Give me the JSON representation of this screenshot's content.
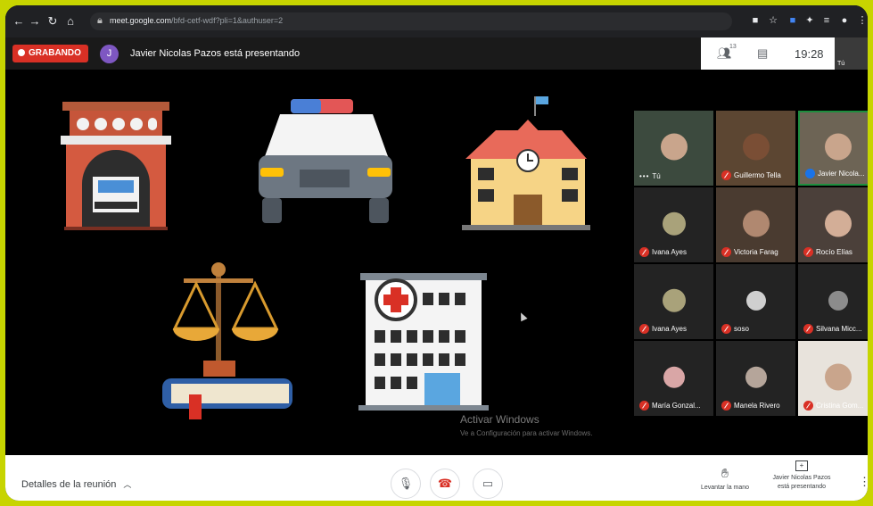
{
  "browser": {
    "url_host": "meet.google.com",
    "url_path": "/bfd-cetf-wdf?pli=1&authuser=2"
  },
  "meet": {
    "recording_label": "GRABANDO",
    "presenter_initial": "J",
    "presenting_text": "Javier Nicolas Pazos está presentando",
    "participant_count": "13",
    "time": "19:28",
    "self_label": "Tú"
  },
  "watermark": {
    "line1": "Activar Windows",
    "line2": "Ve a Configuración para activar Windows."
  },
  "participants": [
    {
      "name": "Tú",
      "muted": false,
      "self": true
    },
    {
      "name": "Guillermo Tella",
      "muted": true
    },
    {
      "name": "Javier Nicola...",
      "muted": false,
      "speaking": true
    },
    {
      "name": "Ivana Ayes",
      "muted": true
    },
    {
      "name": "Victoria Farag",
      "muted": true
    },
    {
      "name": "Rocío Elías",
      "muted": true
    },
    {
      "name": "Ivana Ayes",
      "muted": true
    },
    {
      "name": "soso",
      "muted": true
    },
    {
      "name": "Silvana Micc...",
      "muted": true
    },
    {
      "name": "María Gonzal...",
      "muted": true
    },
    {
      "name": "Manela Rivero",
      "muted": true
    },
    {
      "name": "Cristina Gom...",
      "muted": true
    }
  ],
  "bottom": {
    "details_label": "Detalles de la reunión",
    "raise_hand_label": "Levantar la mano",
    "presenting_line1": "Javier Nicolas Pazos",
    "presenting_line2": "está presentando"
  },
  "colors": {
    "frame": "#c6d500",
    "record_red": "#d93025",
    "presenter_avatar": "#7e57c2"
  }
}
